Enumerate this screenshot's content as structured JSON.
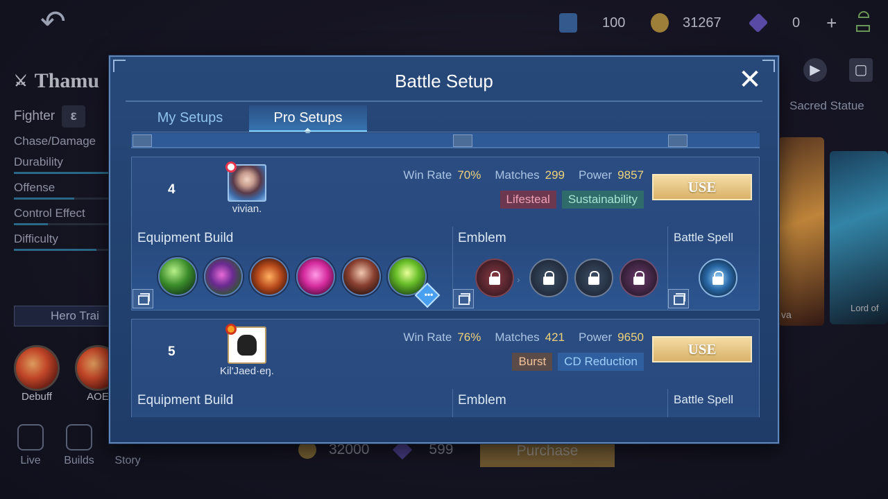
{
  "topbar": {
    "back_icon": "back-arrow-icon",
    "ticket_count": "100",
    "gold_count": "31267",
    "diamond_count": "0",
    "add_label": "+"
  },
  "hero": {
    "name": "Thamu",
    "role": "Fighter",
    "stats": [
      {
        "label": "Chase/Damage",
        "level": null
      },
      {
        "label": "Durability",
        "level": 0.8
      },
      {
        "label": "Offense",
        "level": 0.6
      },
      {
        "label": "Control Effect",
        "level": 0.35
      },
      {
        "label": "Difficulty",
        "level": 0.85
      }
    ],
    "trainer_label": "Hero Trai",
    "skills": [
      "Debuff",
      "AOE"
    ],
    "nav": [
      "Live",
      "Builds",
      "Story"
    ]
  },
  "right_panel": {
    "tab_label": "Sacred Statue",
    "skin_partial_1": "va",
    "skin_partial_2": "Lord of"
  },
  "purchase": {
    "gold_price": "32000",
    "diamond_price": "599",
    "button_label": "Purchase"
  },
  "dialog": {
    "title": "Battle Setup",
    "tabs": [
      {
        "label": "My Setups",
        "active": false
      },
      {
        "label": "Pro Setups",
        "active": true
      }
    ],
    "setups": [
      {
        "rank": "4",
        "player": "vivian.",
        "win_rate_label": "Win Rate",
        "win_rate": "70%",
        "matches_label": "Matches",
        "matches": "299",
        "power_label": "Power",
        "power": "9857",
        "tags": [
          "Lifesteal",
          "Sustainability"
        ],
        "use_label": "USE",
        "equipment_label": "Equipment Build",
        "emblem_label": "Emblem",
        "spell_label": "Battle Spell"
      },
      {
        "rank": "5",
        "player": "Kil'Jaed·eŋ.",
        "win_rate_label": "Win Rate",
        "win_rate": "76%",
        "matches_label": "Matches",
        "matches": "421",
        "power_label": "Power",
        "power": "9650",
        "tags": [
          "Burst",
          "CD Reduction"
        ],
        "use_label": "USE",
        "equipment_label": "Equipment Build",
        "emblem_label": "Emblem",
        "spell_label": "Battle Spell"
      }
    ]
  },
  "colors": {
    "dialog_bg": "#234372",
    "accent_gold": "#f0d27a",
    "tab_active": "#7fd0ff"
  }
}
